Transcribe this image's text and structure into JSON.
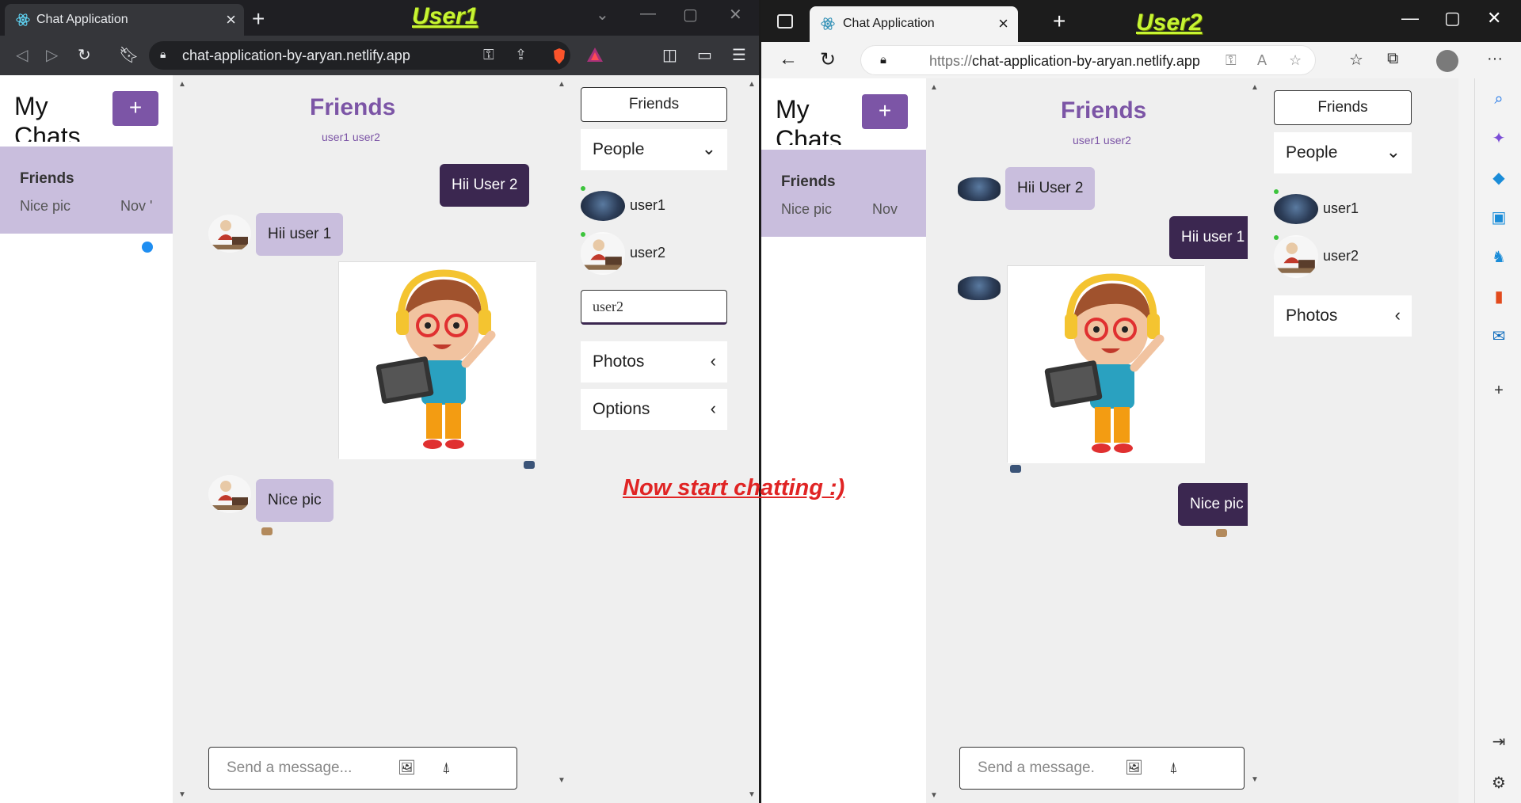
{
  "overlay": {
    "label_left": "User1",
    "label_right": "User2",
    "caption": "Now start chatting :)"
  },
  "window1": {
    "tab_title": "Chat Application",
    "url": "chat-application-by-aryan.netlify.app",
    "icons": [
      "back-icon",
      "forward-icon",
      "reload-icon",
      "bookmark-icon",
      "lock-icon",
      "key-icon",
      "share-icon",
      "brave-shield-icon",
      "brave-rewards-icon",
      "sidebar-icon",
      "wallet-icon",
      "menu-icon"
    ]
  },
  "window2": {
    "tab_title": "Chat Application",
    "url_prefix": "https://",
    "url_host": "chat-application-by-aryan.netlify.app",
    "icons": [
      "back-icon",
      "reload-icon",
      "lock-icon",
      "key-icon",
      "read-aloud-icon",
      "favorite-add-icon",
      "favorites-icon",
      "collections-icon",
      "profile-icon",
      "more-icon"
    ],
    "sidebar_icons": [
      "search-icon",
      "copilot-icon",
      "shopping-icon",
      "tools-icon",
      "games-icon",
      "office-icon",
      "outlook-icon",
      "add-icon",
      "split-screen-icon",
      "settings-icon"
    ]
  },
  "app_user1": {
    "chat_list": {
      "heading": "My Chats",
      "add_button": "+",
      "items": [
        {
          "name": "Friends",
          "last_message": "Nice pic",
          "date": "Nov '",
          "unread": true
        }
      ]
    },
    "feed": {
      "title": "Friends",
      "subtitle": "user1 user2",
      "messages": [
        {
          "from": "me",
          "text": "Hii User 2"
        },
        {
          "from": "them",
          "text": "Hii user 1"
        },
        {
          "from": "me",
          "type": "image"
        },
        {
          "from": "them",
          "text": "Nice pic"
        }
      ],
      "composer_placeholder": "Send a message..."
    },
    "settings": {
      "title_button": "Friends",
      "people_label": "People",
      "people": [
        "user1",
        "user2"
      ],
      "username_input": "user2",
      "photos_label": "Photos",
      "options_label": "Options"
    }
  },
  "app_user2": {
    "chat_list": {
      "heading": "My Chats",
      "add_button": "+",
      "items": [
        {
          "name": "Friends",
          "last_message": "Nice pic",
          "date": "Nov",
          "unread": false
        }
      ]
    },
    "feed": {
      "title": "Friends",
      "subtitle": "user1 user2",
      "messages": [
        {
          "from": "them",
          "text": "Hii User 2"
        },
        {
          "from": "me",
          "text": "Hii user 1"
        },
        {
          "from": "them",
          "type": "image"
        },
        {
          "from": "me",
          "text": "Nice pic"
        }
      ],
      "composer_placeholder": "Send a message."
    },
    "settings": {
      "title_button": "Friends",
      "people_label": "People",
      "people": [
        "user1",
        "user2"
      ],
      "photos_label": "Photos"
    }
  },
  "colors": {
    "accent_purple": "#7c55a6",
    "bubble_dark": "#3b2750",
    "bubble_light": "#c9bedd",
    "unread_dot": "#1f8ef1",
    "online": "#3cc43c",
    "caption_red": "#e02424",
    "label_green": "#c6f533"
  }
}
